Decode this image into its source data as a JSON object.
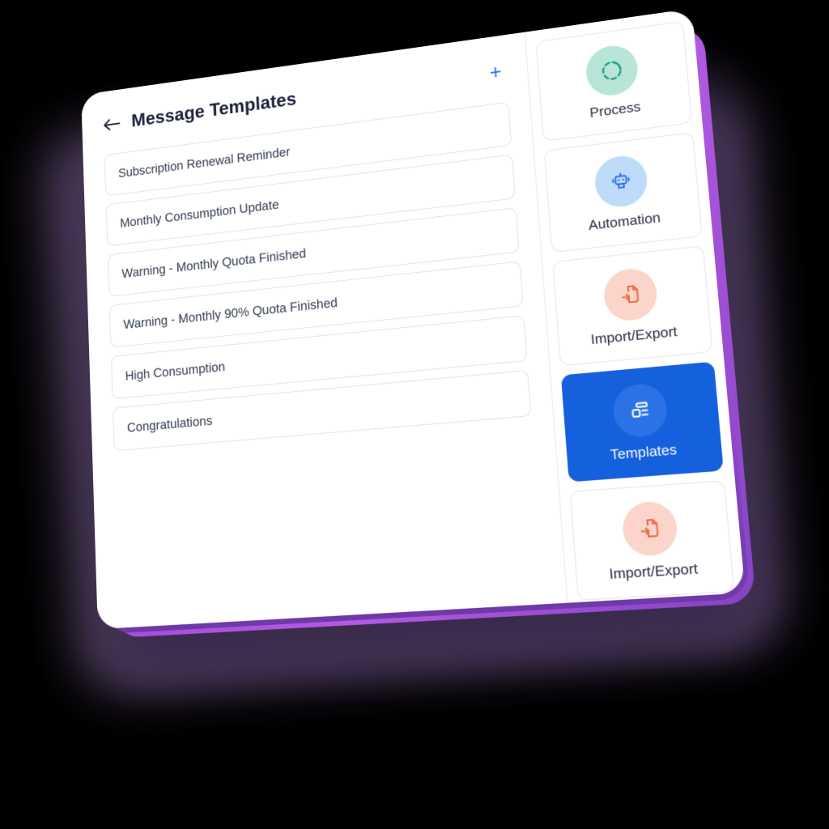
{
  "header": {
    "back_icon": "arrow-left-icon",
    "title": "Message Templates",
    "add_label": "+",
    "title_color": "#1b2137",
    "add_color": "#2e72e8"
  },
  "templates": {
    "items": [
      {
        "label": "Subscription Renewal Reminder"
      },
      {
        "label": "Monthly Consumption Update"
      },
      {
        "label": "Warning - Monthly Quota Finished"
      },
      {
        "label": "Warning - Monthly 90% Quota Finished"
      },
      {
        "label": "High Consumption"
      },
      {
        "label": "Congratulations"
      }
    ]
  },
  "sidebar": {
    "items": [
      {
        "label": "Process",
        "icon": "spinner-circle-icon",
        "circle_color": "#b7e6d8",
        "icon_color": "#1f9e85",
        "active": false
      },
      {
        "label": "Automation",
        "icon": "robot-icon",
        "circle_color": "#bedcfa",
        "icon_color": "#2f6fe0",
        "active": false
      },
      {
        "label": "Import/Export",
        "icon": "file-import-icon",
        "circle_color": "#fbd5c9",
        "icon_color": "#ec6a4a",
        "active": false
      },
      {
        "label": "Templates",
        "icon": "template-layout-icon",
        "circle_color": "#2b72e6",
        "icon_color": "#ffffff",
        "active": true
      },
      {
        "label": "Import/Export",
        "icon": "file-import-icon",
        "circle_color": "#fbd5c9",
        "icon_color": "#ec6a4a",
        "active": false
      }
    ]
  },
  "theme": {
    "accent_blue": "#1560dd",
    "edge_purple": "#a94fdb",
    "edge_purple_dark": "#7b41b8",
    "shadow_purple": "#50405f",
    "background": "#000000"
  }
}
